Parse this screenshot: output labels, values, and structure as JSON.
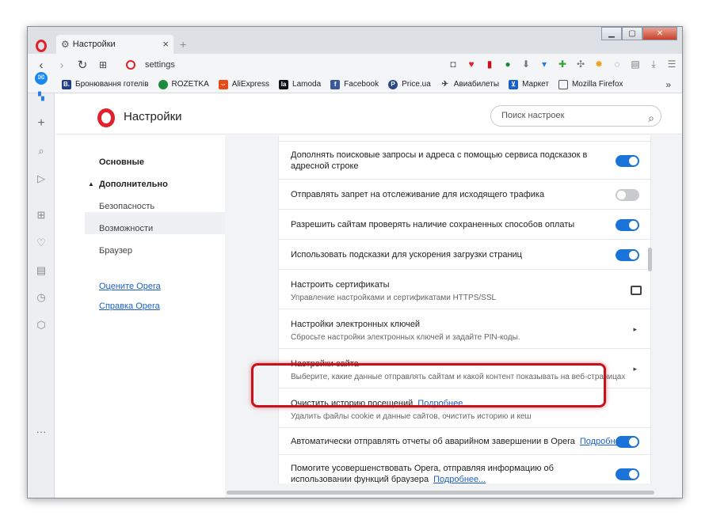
{
  "tab": {
    "title": "Настройки"
  },
  "address": {
    "url": "settings"
  },
  "bookmarks": [
    {
      "label": "Бронювання готелів",
      "icon": "booking-icon",
      "color": "#1f3f8a",
      "glyph": "B."
    },
    {
      "label": "ROZETKA",
      "icon": "rozetka-icon",
      "color": "#1c8c3c",
      "glyph": "●"
    },
    {
      "label": "AliExpress",
      "icon": "aliexpress-icon",
      "color": "#e64a19",
      "glyph": "⌣"
    },
    {
      "label": "Lamoda",
      "icon": "lamoda-icon",
      "color": "#111111",
      "glyph": "la"
    },
    {
      "label": "Facebook",
      "icon": "facebook-icon",
      "color": "#3b5998",
      "glyph": "f"
    },
    {
      "label": "Price.ua",
      "icon": "price-icon",
      "color": "#2a4a8c",
      "glyph": "P"
    },
    {
      "label": "Авиабилеты",
      "icon": "plane-icon",
      "color": "#444444",
      "glyph": "✈"
    },
    {
      "label": "Маркет",
      "icon": "cart-icon",
      "color": "#1a5fc7",
      "glyph": "🛒"
    },
    {
      "label": "Mozilla Firefox",
      "icon": "folder-icon",
      "color": "#555555",
      "glyph": "▭"
    }
  ],
  "header": {
    "title": "Настройки",
    "search_placeholder": "Поиск настроек"
  },
  "nav": {
    "basic": "Основные",
    "advanced": "Дополнительно",
    "security": "Безопасность",
    "features": "Возможности",
    "browser": "Браузер",
    "rate": "Оцените Opera",
    "help": "Справка Opera"
  },
  "settings": {
    "suggest": {
      "title": "Дополнять поисковые запросы и адреса с помощью сервиса подсказок в адресной строке",
      "enabled": true
    },
    "dnt": {
      "title": "Отправлять запрет на отслеживание для исходящего трафика",
      "enabled": false
    },
    "payment": {
      "title": "Разрешить сайтам проверять наличие сохраненных способов оплаты",
      "enabled": true
    },
    "preload": {
      "title": "Использовать подсказки для ускорения загрузки страниц",
      "enabled": true
    },
    "certs": {
      "title": "Настроить сертификаты",
      "subtitle": "Управление настройками и сертификатами HTTPS/SSL"
    },
    "keys": {
      "title": "Настройки электронных ключей",
      "subtitle": "Сбросьте настройки электронных ключей и задайте PIN-коды."
    },
    "site": {
      "title": "Настройки сайта",
      "subtitle": "Выберите, какие данные отправлять сайтам и какой контент показывать на веб-страницах"
    },
    "clear": {
      "title": "Очистить историю посещений",
      "link": "Подробнее...",
      "subtitle": "Удалить файлы cookie и данные сайтов, очистить историю и кеш"
    },
    "crash": {
      "title": "Автоматически отправлять отчеты об аварийном завершении в Opera",
      "link": "Подробнее...",
      "enabled": true
    },
    "improve": {
      "title": "Помогите усовершенствовать Opera, отправляя информацию об использовании функций браузера",
      "link": "Подробнее...",
      "enabled": true
    }
  },
  "colors": {
    "accent": "#1a73d9",
    "opera_red": "#e0212b",
    "highlight": "#c8121b"
  }
}
